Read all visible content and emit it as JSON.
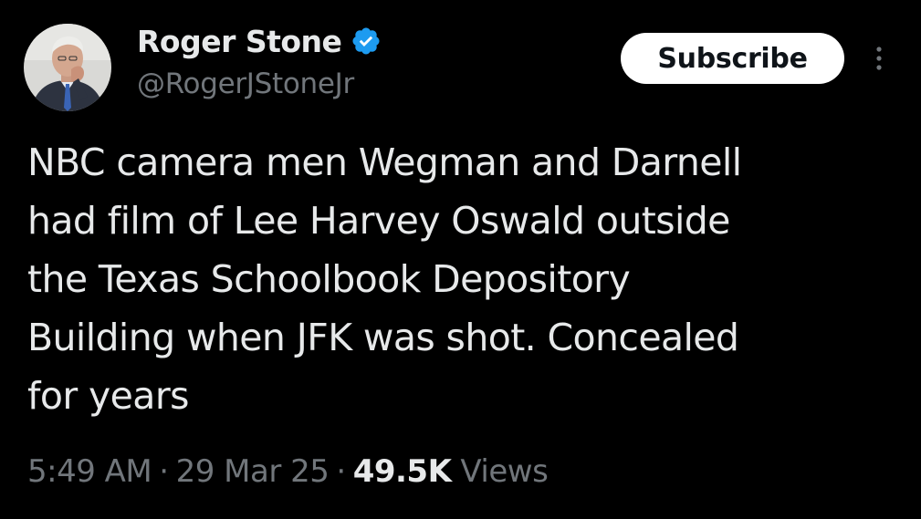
{
  "author": {
    "display_name": "Roger Stone",
    "handle": "@RogerJStoneJr",
    "verified_icon": "verified-badge-icon",
    "verified_color": "#1d9bf0"
  },
  "actions": {
    "subscribe_label": "Subscribe",
    "more_icon": "more-vertical-icon"
  },
  "tweet": {
    "text_lines": [
      "NBC camera men Wegman and Darnell",
      "had film of Lee Harvey Oswald outside",
      "the Texas Schoolbook Depository",
      "Building when JFK was shot. Concealed",
      "for years"
    ]
  },
  "meta": {
    "time": "5:49 AM",
    "separator": "·",
    "date": "29 Mar 25",
    "views_count": "49.5K",
    "views_label": "Views"
  },
  "colors": {
    "background": "#000000",
    "primary_text": "#e7e9ea",
    "secondary_text": "#71767b",
    "button_bg": "#ffffff",
    "button_text": "#0f1419"
  }
}
